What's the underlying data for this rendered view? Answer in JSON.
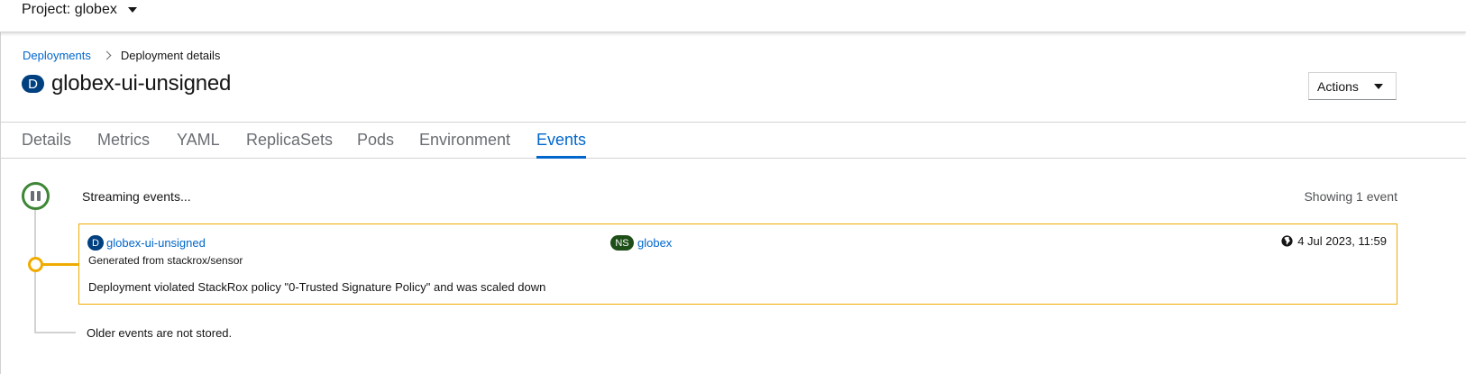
{
  "project": {
    "label": "Project: globex"
  },
  "breadcrumb": {
    "parent": "Deployments",
    "current": "Deployment details"
  },
  "title": {
    "badge": "D",
    "name": "globex-ui-unsigned"
  },
  "actions": {
    "label": "Actions"
  },
  "tabs": [
    {
      "label": "Details"
    },
    {
      "label": "Metrics"
    },
    {
      "label": "YAML"
    },
    {
      "label": "ReplicaSets"
    },
    {
      "label": "Pods"
    },
    {
      "label": "Environment"
    },
    {
      "label": "Events",
      "active": true
    }
  ],
  "events": {
    "status": "Streaming events...",
    "count_text": "Showing 1 event",
    "items": [
      {
        "object_badge": "D",
        "object_name": "globex-ui-unsigned",
        "namespace_badge": "NS",
        "namespace": "globex",
        "timestamp": "4 Jul 2023, 11:59",
        "source": "Generated from stackrox/sensor",
        "message": "Deployment violated StackRox policy \"0-Trusted Signature Policy\" and was scaled down"
      }
    ],
    "footer": "Older events are not stored."
  },
  "colors": {
    "link": "#0066cc",
    "warning": "#f0ab00",
    "success": "#3e8635",
    "deployment_badge": "#004080",
    "namespace_badge": "#1e4f18"
  },
  "icons": [
    "caret-down-icon",
    "chevron-right-icon",
    "pause-icon",
    "globe-icon"
  ]
}
